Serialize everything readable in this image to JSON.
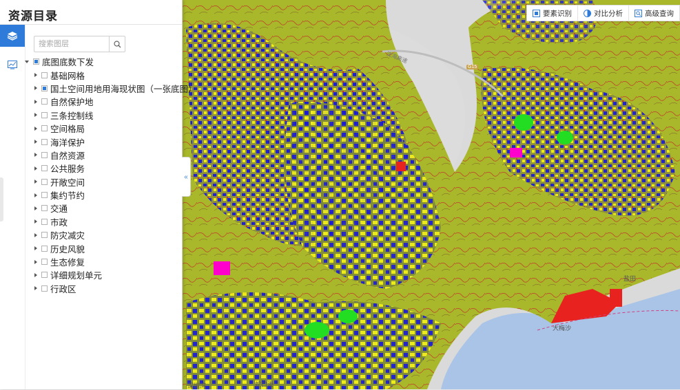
{
  "panel": {
    "title": "资源目录",
    "search_placeholder": "搜索图层",
    "tree": [
      {
        "label": "底图底数下发",
        "level": 0,
        "expanded": true,
        "state": "partial"
      },
      {
        "label": "基础网格",
        "level": 1,
        "expanded": false,
        "state": "none"
      },
      {
        "label": "国土空间用地用海现状图（一张底图）",
        "level": 1,
        "expanded": false,
        "state": "partial"
      },
      {
        "label": "自然保护地",
        "level": 1,
        "expanded": false,
        "state": "none"
      },
      {
        "label": "三条控制线",
        "level": 1,
        "expanded": false,
        "state": "none"
      },
      {
        "label": "空间格局",
        "level": 1,
        "expanded": false,
        "state": "none"
      },
      {
        "label": "海洋保护",
        "level": 1,
        "expanded": false,
        "state": "none"
      },
      {
        "label": "自然资源",
        "level": 1,
        "expanded": false,
        "state": "none"
      },
      {
        "label": "公共服务",
        "level": 1,
        "expanded": false,
        "state": "none"
      },
      {
        "label": "开敞空间",
        "level": 1,
        "expanded": false,
        "state": "none"
      },
      {
        "label": "集约节约",
        "level": 1,
        "expanded": false,
        "state": "none"
      },
      {
        "label": "交通",
        "level": 1,
        "expanded": false,
        "state": "none"
      },
      {
        "label": "市政",
        "level": 1,
        "expanded": false,
        "state": "none"
      },
      {
        "label": "防灾减灾",
        "level": 1,
        "expanded": false,
        "state": "none"
      },
      {
        "label": "历史风貌",
        "level": 1,
        "expanded": false,
        "state": "none"
      },
      {
        "label": "生态修复",
        "level": 1,
        "expanded": false,
        "state": "none"
      },
      {
        "label": "详细规划单元",
        "level": 1,
        "expanded": false,
        "state": "none"
      },
      {
        "label": "行政区",
        "level": 1,
        "expanded": false,
        "state": "none"
      }
    ]
  },
  "toolbar": {
    "items": [
      {
        "label": "要素识别",
        "icon": "select-icon"
      },
      {
        "label": "对比分析",
        "icon": "half-circle-icon"
      },
      {
        "label": "高级查询",
        "icon": "query-icon"
      }
    ]
  },
  "map": {
    "road_label": "沈海高速",
    "shield": "G15",
    "place_labels": [
      "盐田",
      "大梅沙",
      "蛇口港",
      "深圳湾"
    ]
  },
  "colors": {
    "accent": "#2f7bd9",
    "land_green": "#a9b82a",
    "residential_yellow": "#f2ef1c",
    "commercial_blue": "#1a1ad0",
    "red": "#e8231f",
    "park_green": "#22dd22",
    "water": "#a9c4e6",
    "boundary": "#e02020"
  }
}
